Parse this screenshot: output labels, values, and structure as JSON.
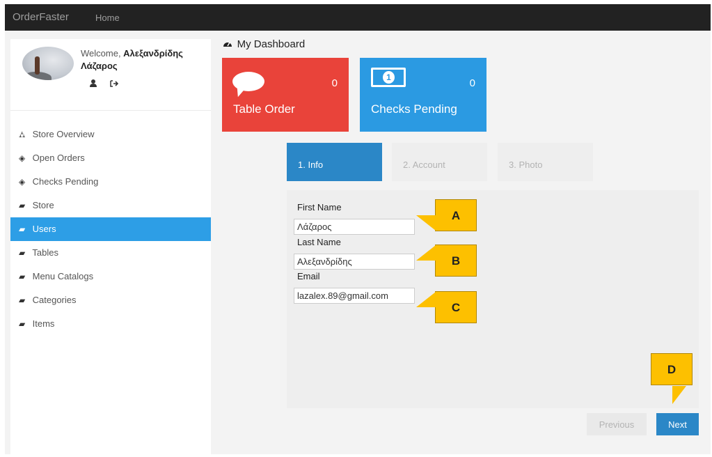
{
  "navbar": {
    "brand": "OrderFaster",
    "home": "Home"
  },
  "profile": {
    "welcome_prefix": "Welcome, ",
    "name_line1": "Αλεξανδρίδης",
    "name_line2": "Λάζαρος",
    "icons": [
      "user-icon",
      "sign-out-icon"
    ]
  },
  "sidebar": {
    "items": [
      {
        "label": "Store Overview",
        "icon": "sitemap-icon",
        "glyph": "⛼"
      },
      {
        "label": "Open Orders",
        "icon": "diamond-icon",
        "glyph": "◈"
      },
      {
        "label": "Checks Pending",
        "icon": "diamond-icon",
        "glyph": "◈"
      },
      {
        "label": "Store",
        "icon": "book-icon",
        "glyph": "▰"
      },
      {
        "label": "Users",
        "icon": "book-icon",
        "glyph": "▰"
      },
      {
        "label": "Tables",
        "icon": "book-icon",
        "glyph": "▰"
      },
      {
        "label": "Menu Catalogs",
        "icon": "book-icon",
        "glyph": "▰"
      },
      {
        "label": "Categories",
        "icon": "book-icon",
        "glyph": "▰"
      },
      {
        "label": "Items",
        "icon": "book-icon",
        "glyph": "▰"
      }
    ],
    "active_index": 4
  },
  "dashboard": {
    "title": "My Dashboard",
    "icon": "dashboard-icon"
  },
  "tiles": [
    {
      "label": "Table Order",
      "count": "0",
      "color": "#e9433a",
      "icon": "comment-icon"
    },
    {
      "label": "Checks Pending",
      "count": "0",
      "color": "#2b9ae2",
      "icon": "money-icon"
    }
  ],
  "steps": [
    "1. Info",
    "2. Account",
    "3. Photo"
  ],
  "form": {
    "first_name": {
      "label": "First Name",
      "value": "Λάζαρος"
    },
    "last_name": {
      "label": "Last Name",
      "value": "Αλεξανδρίδης"
    },
    "email": {
      "label": "Email",
      "value": "lazalex.89@gmail.com"
    }
  },
  "callouts": {
    "a": "A",
    "b": "B",
    "c": "C",
    "d": "D"
  },
  "buttons": {
    "previous": "Previous",
    "next": "Next"
  },
  "colors": {
    "accent": "#2d9ee6",
    "step_active": "#2b87c7",
    "callout": "#fdc000"
  }
}
